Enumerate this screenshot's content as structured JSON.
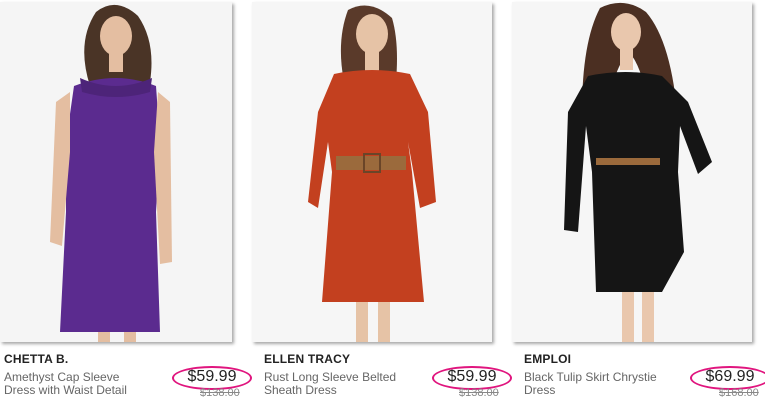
{
  "products": [
    {
      "brand": "CHETTA B.",
      "name": "Amethyst Cap Sleeve Dress with Waist Detail",
      "price": "$59.99",
      "original_price": "$138.00",
      "dress_color": "#5b2b8f"
    },
    {
      "brand": "ELLEN TRACY",
      "name": "Rust Long Sleeve Belted Sheath Dress",
      "price": "$59.99",
      "original_price": "$138.00",
      "dress_color": "#c3401f"
    },
    {
      "brand": "EMPLOI",
      "name": "Black Tulip Skirt Chrystie Dress",
      "price": "$69.99",
      "original_price": "$168.00",
      "dress_color": "#151515"
    }
  ],
  "colors": {
    "price_highlight": "#e0157e"
  }
}
